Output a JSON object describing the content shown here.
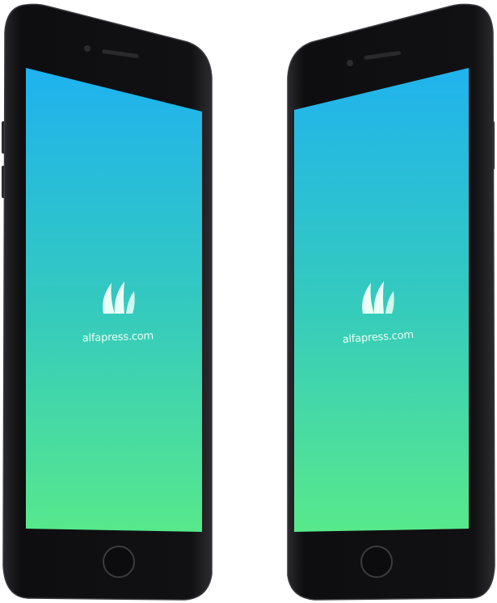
{
  "scene": {
    "description_label": "phone-mockups",
    "background": "#ffffff"
  },
  "phones": [
    {
      "id": "left",
      "brand_text": "alfapress.com",
      "logo_icon": "alfapress-logo-icon",
      "screen_gradient": {
        "top": "#1fb2ef",
        "bottom": "#57e88c"
      },
      "body_color": "#141416"
    },
    {
      "id": "right",
      "brand_text": "alfapress.com",
      "logo_icon": "alfapress-logo-icon",
      "screen_gradient": {
        "top": "#1fb2ef",
        "bottom": "#57e88c"
      },
      "body_color": "#141416"
    }
  ]
}
